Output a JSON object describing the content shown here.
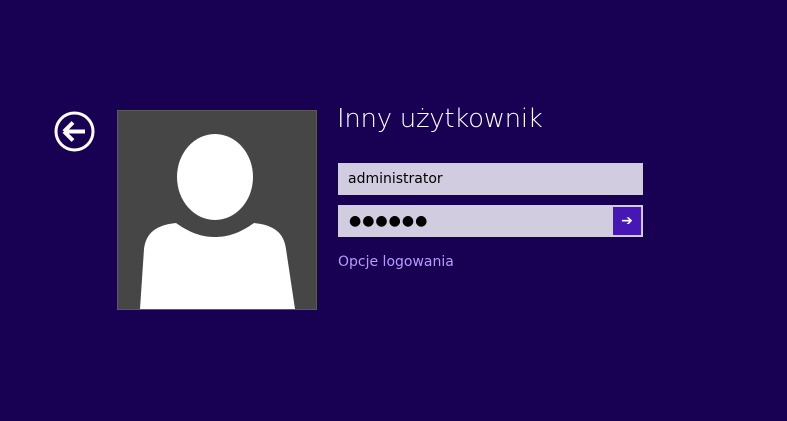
{
  "login": {
    "title": "Inny użytkownik",
    "username_value": "administrator",
    "password_mask": "●●●●●●",
    "submit_glyph": "➔",
    "signin_options_label": "Opcje logowania"
  },
  "icons": {
    "back": "back-arrow-circle-icon",
    "avatar": "default-user-avatar-icon",
    "submit": "arrow-right-icon"
  },
  "colors": {
    "background": "#180052",
    "avatar_background": "#464646",
    "field_background": "#d2cce0",
    "submit_button": "#4617b4",
    "link": "#b59cff"
  }
}
